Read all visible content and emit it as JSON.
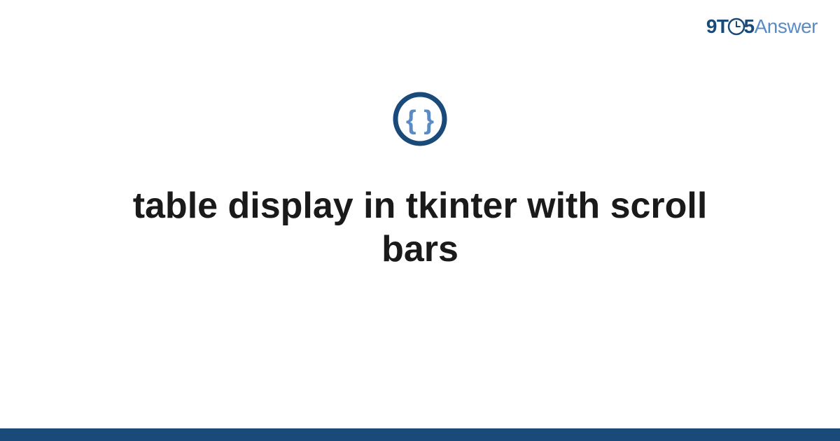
{
  "header": {
    "logo_9t": "9T",
    "logo_5": "5",
    "logo_answer": "Answer"
  },
  "main": {
    "title": "table display in tkinter with scroll bars"
  },
  "colors": {
    "primary_dark": "#1a4a7a",
    "primary_light": "#5a8bc4",
    "text": "#1a1a1a"
  }
}
